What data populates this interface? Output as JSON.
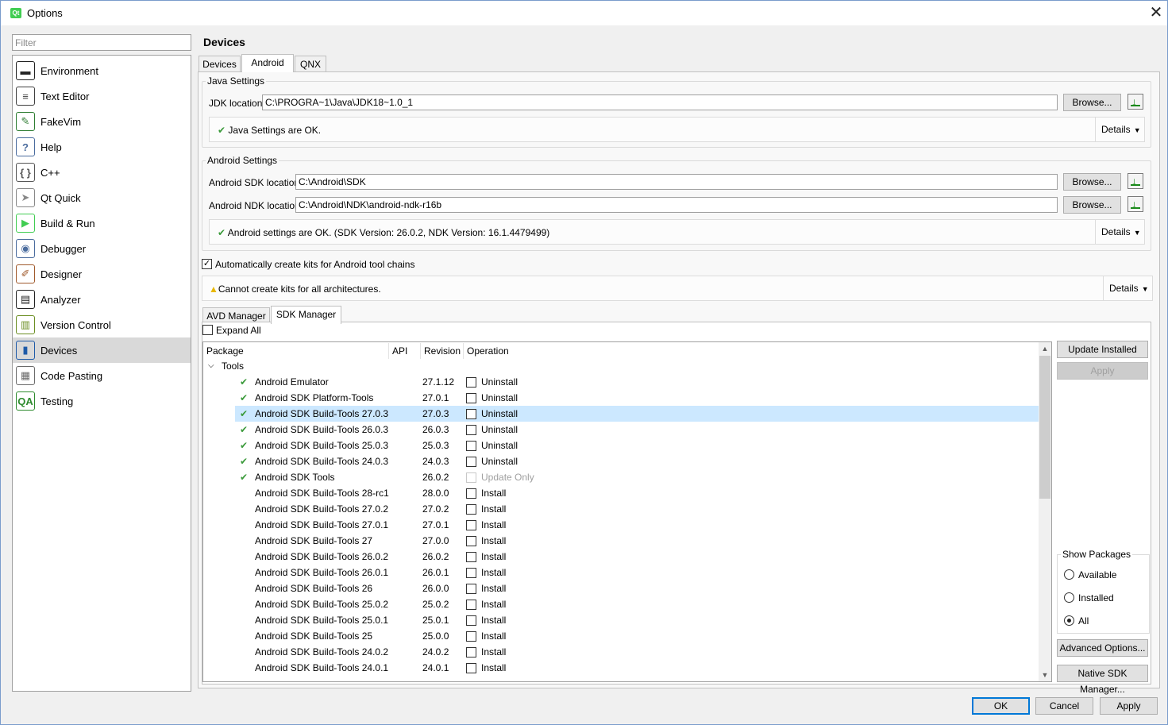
{
  "window": {
    "title": "Options",
    "app_icon": "qt-creator-icon",
    "close_glyph": "✕"
  },
  "filter": {
    "placeholder": "Filter"
  },
  "sidebar": {
    "items": [
      {
        "label": "Environment",
        "icon": "environment-icon",
        "glyph": "▬",
        "color": "#222222"
      },
      {
        "label": "Text Editor",
        "icon": "text-editor-icon",
        "glyph": "≡",
        "color": "#404040"
      },
      {
        "label": "FakeVim",
        "icon": "fakevim-icon",
        "glyph": "✎",
        "color": "#2e7d32"
      },
      {
        "label": "Help",
        "icon": "help-icon",
        "glyph": "?",
        "color": "#4b6c9e"
      },
      {
        "label": "C++",
        "icon": "cpp-icon",
        "glyph": "{ }",
        "color": "#555555"
      },
      {
        "label": "Qt Quick",
        "icon": "qt-quick-icon",
        "glyph": "➤",
        "color": "#888888"
      },
      {
        "label": "Build & Run",
        "icon": "build-run-icon",
        "glyph": "▶",
        "color": "#41cd52"
      },
      {
        "label": "Debugger",
        "icon": "debugger-icon",
        "glyph": "◉",
        "color": "#4b6c9e"
      },
      {
        "label": "Designer",
        "icon": "designer-icon",
        "glyph": "✐",
        "color": "#a05a2c"
      },
      {
        "label": "Analyzer",
        "icon": "analyzer-icon",
        "glyph": "▤",
        "color": "#222222"
      },
      {
        "label": "Version Control",
        "icon": "version-control-icon",
        "glyph": "▥",
        "color": "#6b8e23"
      },
      {
        "label": "Devices",
        "icon": "devices-icon",
        "glyph": "▮",
        "color": "#1e5aa8"
      },
      {
        "label": "Code Pasting",
        "icon": "code-pasting-icon",
        "glyph": "▦",
        "color": "#6b6b6b"
      },
      {
        "label": "Testing",
        "icon": "testing-icon",
        "glyph": "QA",
        "color": "#2e8b2e"
      }
    ],
    "selected_index": 11
  },
  "page": {
    "heading": "Devices",
    "tabs": [
      "Devices",
      "Android",
      "QNX"
    ],
    "active_tab": "Android"
  },
  "java": {
    "group_title": "Java Settings",
    "jdk_label": "JDK location:",
    "jdk_value": "C:\\PROGRA~1\\Java\\JDK18~1.0_1",
    "browse": "Browse...",
    "status": "Java Settings are OK.",
    "details": "Details"
  },
  "android": {
    "group_title": "Android Settings",
    "sdk_label": "Android SDK location:",
    "sdk_value": "C:\\Android\\SDK",
    "ndk_label": "Android NDK location:",
    "ndk_value": "C:\\Android\\NDK\\android-ndk-r16b",
    "browse": "Browse...",
    "status": "Android settings are OK. (SDK Version: 26.0.2, NDK Version: 16.1.4479499)",
    "details": "Details"
  },
  "kits": {
    "auto_create_label": "Automatically create kits for Android tool chains",
    "auto_create_checked": true,
    "warning": "Cannot create kits for all architectures.",
    "details": "Details"
  },
  "subtabs": {
    "items": [
      "AVD Manager",
      "SDK Manager"
    ],
    "active": "SDK Manager"
  },
  "sdk": {
    "expand_all_label": "Expand All",
    "columns": [
      "Package",
      "API",
      "Revision",
      "Operation"
    ],
    "group": "Tools",
    "packages": [
      {
        "name": "Android Emulator",
        "installed": true,
        "revision": "27.1.12",
        "operation": "Uninstall"
      },
      {
        "name": "Android SDK Platform-Tools",
        "installed": true,
        "revision": "27.0.1",
        "operation": "Uninstall"
      },
      {
        "name": "Android SDK Build-Tools 27.0.3",
        "installed": true,
        "revision": "27.0.3",
        "operation": "Uninstall",
        "selected": true
      },
      {
        "name": "Android SDK Build-Tools 26.0.3",
        "installed": true,
        "revision": "26.0.3",
        "operation": "Uninstall"
      },
      {
        "name": "Android SDK Build-Tools 25.0.3",
        "installed": true,
        "revision": "25.0.3",
        "operation": "Uninstall"
      },
      {
        "name": "Android SDK Build-Tools 24.0.3",
        "installed": true,
        "revision": "24.0.3",
        "operation": "Uninstall"
      },
      {
        "name": "Android SDK Tools",
        "installed": true,
        "revision": "26.0.2",
        "operation": "Update Only",
        "disabled": true
      },
      {
        "name": "Android SDK Build-Tools 28-rc1",
        "installed": false,
        "revision": "28.0.0",
        "operation": "Install"
      },
      {
        "name": "Android SDK Build-Tools 27.0.2",
        "installed": false,
        "revision": "27.0.2",
        "operation": "Install"
      },
      {
        "name": "Android SDK Build-Tools 27.0.1",
        "installed": false,
        "revision": "27.0.1",
        "operation": "Install"
      },
      {
        "name": "Android SDK Build-Tools 27",
        "installed": false,
        "revision": "27.0.0",
        "operation": "Install"
      },
      {
        "name": "Android SDK Build-Tools 26.0.2",
        "installed": false,
        "revision": "26.0.2",
        "operation": "Install"
      },
      {
        "name": "Android SDK Build-Tools 26.0.1",
        "installed": false,
        "revision": "26.0.1",
        "operation": "Install"
      },
      {
        "name": "Android SDK Build-Tools 26",
        "installed": false,
        "revision": "26.0.0",
        "operation": "Install"
      },
      {
        "name": "Android SDK Build-Tools 25.0.2",
        "installed": false,
        "revision": "25.0.2",
        "operation": "Install"
      },
      {
        "name": "Android SDK Build-Tools 25.0.1",
        "installed": false,
        "revision": "25.0.1",
        "operation": "Install"
      },
      {
        "name": "Android SDK Build-Tools 25",
        "installed": false,
        "revision": "25.0.0",
        "operation": "Install"
      },
      {
        "name": "Android SDK Build-Tools 24.0.2",
        "installed": false,
        "revision": "24.0.2",
        "operation": "Install"
      },
      {
        "name": "Android SDK Build-Tools 24.0.1",
        "installed": false,
        "revision": "24.0.1",
        "operation": "Install"
      }
    ],
    "buttons": {
      "update_installed": "Update Installed",
      "apply": "Apply",
      "advanced": "Advanced Options...",
      "native": "Native SDK Manager..."
    },
    "show_packages": {
      "title": "Show Packages",
      "options": [
        "Available",
        "Installed",
        "All"
      ],
      "selected": "All"
    }
  },
  "footer": {
    "ok": "OK",
    "cancel": "Cancel",
    "apply": "Apply"
  },
  "colors": {
    "selection": "#cce8ff",
    "check": "#3a9a3a",
    "accent": "#0078d7"
  }
}
